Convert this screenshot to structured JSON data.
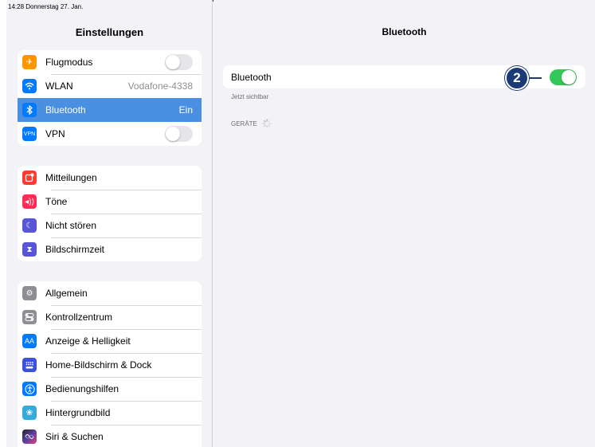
{
  "status": {
    "time": "14:28",
    "date": "Donnerstag 27. Jan."
  },
  "sidebar": {
    "title": "Einstellungen",
    "group1": [
      {
        "label": "Flugmodus",
        "icon": "airplane-icon",
        "color": "#ff9500",
        "toggle": false
      },
      {
        "label": "WLAN",
        "value": "Vodafone-4338",
        "icon": "wifi-icon",
        "color": "#007aff"
      },
      {
        "label": "Bluetooth",
        "value": "Ein",
        "icon": "bluetooth-icon",
        "color": "#007aff",
        "selected": true
      },
      {
        "label": "VPN",
        "icon": "vpn-icon",
        "color": "#007aff",
        "icon_text": "VPN",
        "toggle": false
      }
    ],
    "group2": [
      {
        "label": "Mitteilungen",
        "icon": "notifications-icon",
        "color": "#ff3b30"
      },
      {
        "label": "Töne",
        "icon": "sounds-icon",
        "color": "#ff2d55"
      },
      {
        "label": "Nicht stören",
        "icon": "moon-icon",
        "color": "#5856d6"
      },
      {
        "label": "Bildschirmzeit",
        "icon": "hourglass-icon",
        "color": "#5856d6"
      }
    ],
    "group3": [
      {
        "label": "Allgemein",
        "icon": "gear-icon",
        "color": "#8e8e93"
      },
      {
        "label": "Kontrollzentrum",
        "icon": "control-center-icon",
        "color": "#8e8e93"
      },
      {
        "label": "Anzeige & Helligkeit",
        "icon": "display-icon",
        "color": "#007aff",
        "icon_text": "AA"
      },
      {
        "label": "Home-Bildschirm & Dock",
        "icon": "home-screen-icon",
        "color": "#3b52d9"
      },
      {
        "label": "Bedienungshilfen",
        "icon": "accessibility-icon",
        "color": "#007aff"
      },
      {
        "label": "Hintergrundbild",
        "icon": "wallpaper-icon",
        "color": "#35aadc"
      },
      {
        "label": "Siri & Suchen",
        "icon": "siri-icon",
        "color": "#222222"
      }
    ]
  },
  "main": {
    "title": "Bluetooth",
    "bluetooth_label": "Bluetooth",
    "bluetooth_on": true,
    "visible_text": "Jetzt sichtbar",
    "devices_header": "GERÄTE",
    "callout": "2"
  }
}
